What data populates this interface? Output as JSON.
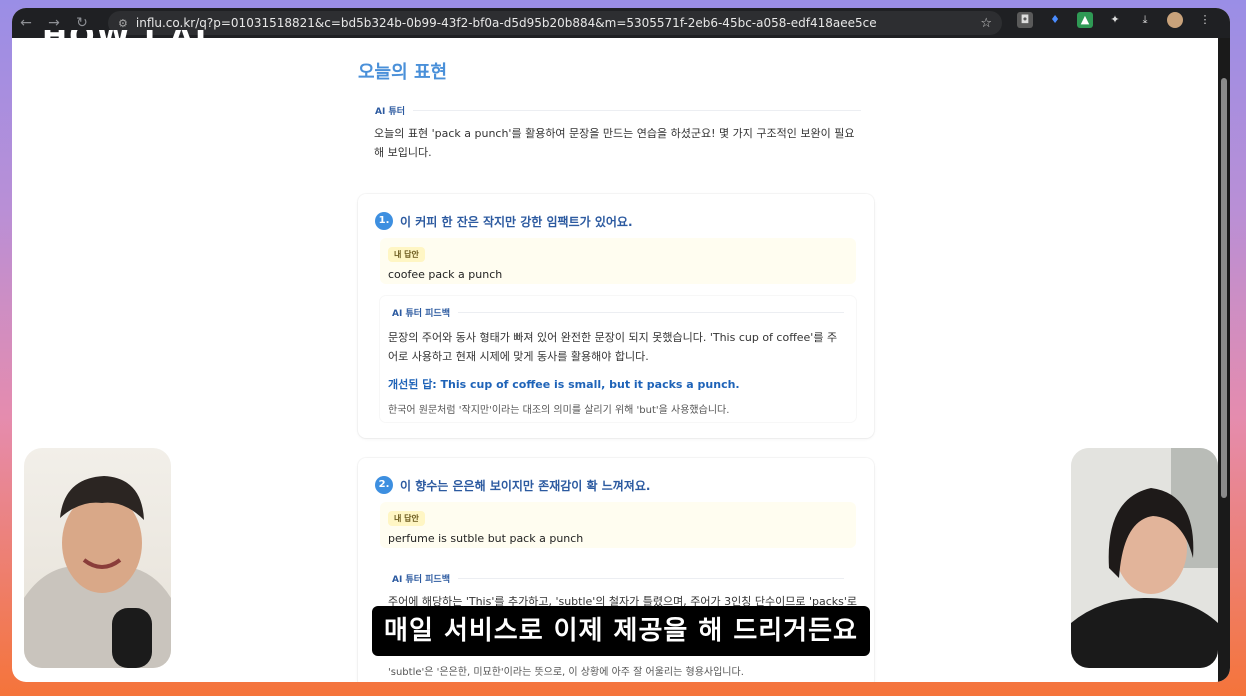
{
  "browser": {
    "url": "influ.co.kr/q?p=01031518821&c=bd5b324b-0b99-43f2-bf0a-d5d95b20b884&m=5305571f-2eb6-45bc-a058-edf418aee5ce",
    "nav": {
      "back": "←",
      "forward": "→",
      "reload": "↻"
    },
    "star": "☆"
  },
  "logo_text": "HOW I AI",
  "page": {
    "title": "오늘의 표현",
    "tutor_intro": {
      "label": "AI 튜터",
      "text": "오늘의 표현 'pack a punch'를 활용하여 문장을 만드는 연습을 하셨군요! 몇 가지 구조적인 보완이 필요해 보입니다."
    },
    "questions": [
      {
        "number": "1.",
        "prompt": "이 커피 한 잔은 작지만 강한 임팩트가 있어요.",
        "answer_label": "내 답안",
        "answer": "coofee pack a punch",
        "feedback_label": "AI 튜터 피드백",
        "feedback": "문장의 주어와 동사 형태가 빠져 있어 완전한 문장이 되지 못했습니다. 'This cup of coffee'를 주어로 사용하고 현재 시제에 맞게 동사를 활용해야 합니다.",
        "improved": "개선된 답: This cup of coffee is small, but it packs a punch.",
        "note": "한국어 원문처럼 '작지만'이라는 대조의 의미를 살리기 위해 'but'을 사용했습니다."
      },
      {
        "number": "2.",
        "prompt": "이 향수는 은은해 보이지만 존재감이 확 느껴져요.",
        "answer_label": "내 답안",
        "answer": "perfume is sutble but pack a punch",
        "feedback_label": "AI 튜터 피드백",
        "feedback": "주어에 해당하는 'This'를 추가하고, 'subtle'의 철자가 틀렸으며, 주어가 3인칭 단수이므로 'packs'로 동",
        "note": "'subtle'은 '은은한, 미묘한'이라는 뜻으로, 이 상황에 아주 잘 어울리는 형용사입니다."
      }
    ]
  },
  "subtitle": "매일 서비스로 이제 제공을 해 드리거든요"
}
